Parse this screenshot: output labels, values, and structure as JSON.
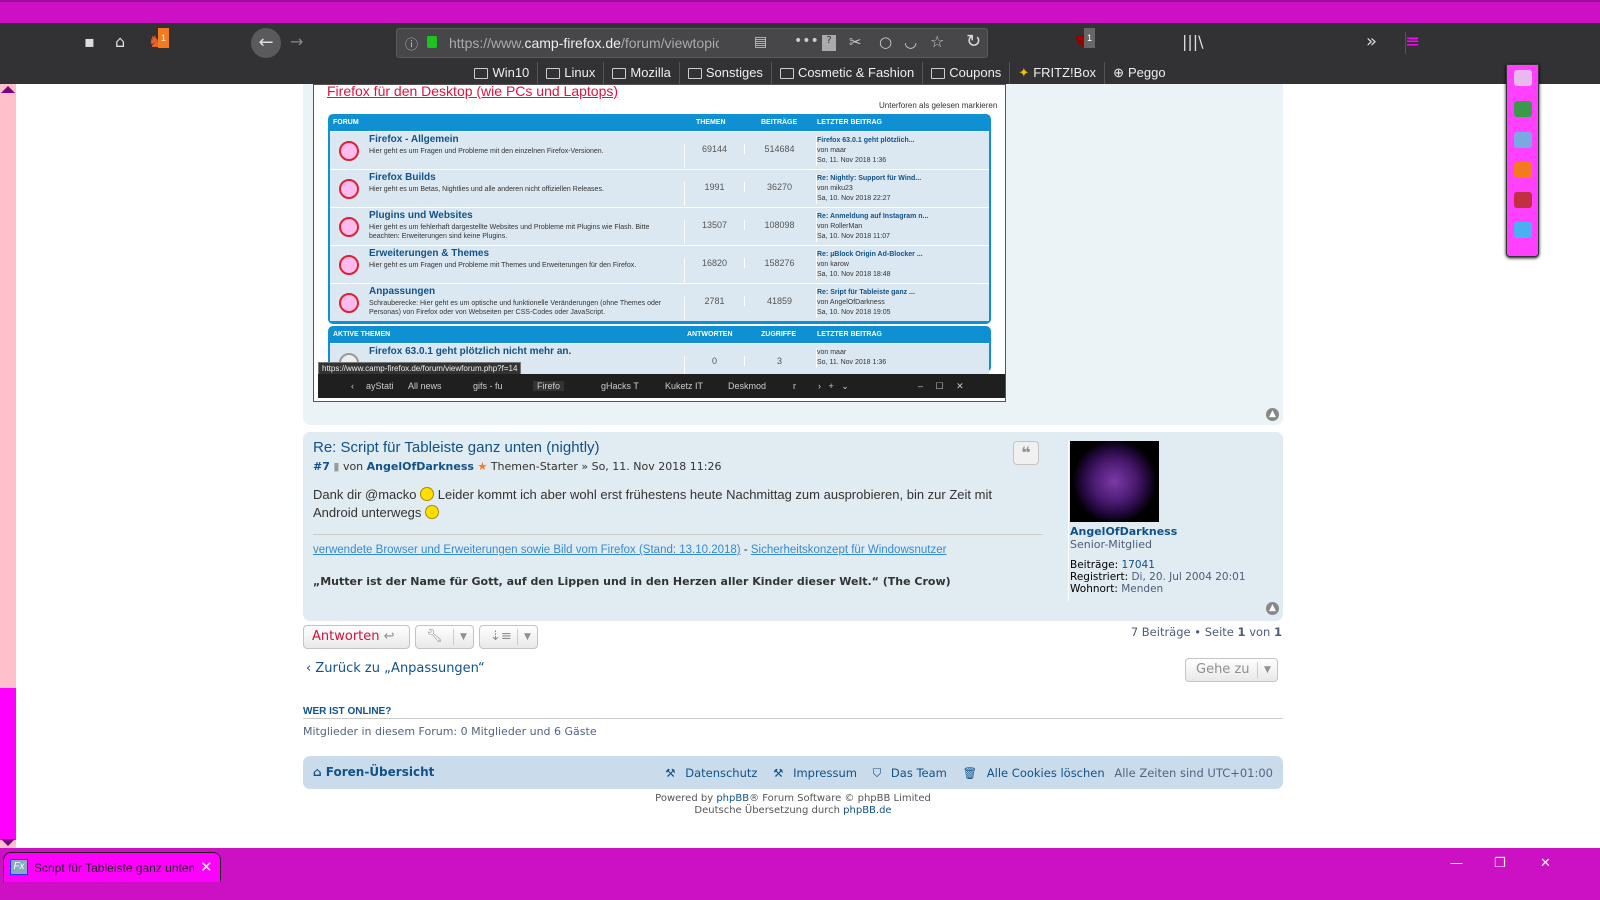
{
  "browser": {
    "url_prefix": "https://www.",
    "url_domain": "camp-firefox.de",
    "url_path": "/forum/viewtopic",
    "addon_badge": "1",
    "ublock_badge": "1",
    "bookmarks": [
      "Win10",
      "Linux",
      "Mozilla",
      "Sonstiges",
      "Cosmetic & Fashion",
      "Coupons",
      "FRITZ!Box",
      "Peggo"
    ],
    "tab_title": "Script für Tableiste ganz unten (nightly)",
    "tab_favicon": "Fx"
  },
  "embedded": {
    "title": "Firefox für den Desktop (wie PCs und Laptops)",
    "mark_read": "Unterforen als gelesen markieren",
    "headers": [
      "FORUM",
      "THEMEN",
      "BEITRÄGE",
      "LETZTER BEITRAG"
    ],
    "forums": [
      {
        "name": "Firefox - Allgemein",
        "desc": "Hier geht es um Fragen und Probleme mit den einzelnen Firefox-Versionen.",
        "topics": "69144",
        "posts": "514684",
        "last_title": "Firefox 63.0.1 geht plötzlich...",
        "last_by": "von maar",
        "last_date": "So, 11. Nov 2018 1:36"
      },
      {
        "name": "Firefox Builds",
        "desc": "Hier geht es um Betas, Nightlies und alle anderen nicht offiziellen Releases.",
        "topics": "1991",
        "posts": "36270",
        "last_title": "Re: Nightly: Support für Wind...",
        "last_by": "von miku23",
        "last_date": "Sa, 10. Nov 2018 22:27"
      },
      {
        "name": "Plugins und Websites",
        "desc": "Hier geht es um fehlerhaft dargestellte Websites und Probleme mit Plugins wie Flash. Bitte beachten: Erweiterungen sind keine Plugins.",
        "topics": "13507",
        "posts": "108098",
        "last_title": "Re: Anmeldung auf Instagram n...",
        "last_by": "von RollerMan",
        "last_date": "Sa, 10. Nov 2018 11:07"
      },
      {
        "name": "Erweiterungen & Themes",
        "desc": "Hier geht es um Fragen und Probleme mit Themes und Erweiterungen für den Firefox.",
        "topics": "16820",
        "posts": "158276",
        "last_title": "Re: µBlock Origin Ad-Blocker ...",
        "last_by": "von karow",
        "last_date": "Sa, 10. Nov 2018 18:48"
      },
      {
        "name": "Anpassungen",
        "desc": "Schrauberecke: Hier geht es um optische und funktionelle Veränderungen (ohne Themes oder Personas) von Firefox oder von Webseiten per CSS-Codes oder JavaScript.",
        "topics": "2781",
        "posts": "41859",
        "last_title": "Re: Sript für Tableiste ganz ...",
        "last_by": "von AngelOfDarkness",
        "last_date": "Sa, 10. Nov 2018 19:05"
      }
    ],
    "active_headers": [
      "AKTIVE THEMEN",
      "ANTWORTEN",
      "ZUGRIFFE",
      "LETZTER BEITRAG"
    ],
    "active": {
      "name": "Firefox 63.0.1 geht plötzlich nicht mehr an.",
      "replies": "0",
      "views": "3",
      "last_by": "von maar",
      "last_date": "So, 11. Nov 2018 1:36"
    },
    "status_url": "https://www.camp-firefox.de/forum/viewforum.php?f=14",
    "taskbar": [
      "ayStati",
      "All news",
      "gifs - fu",
      "Firefo",
      "gHacks T",
      "Kuketz IT",
      "Deskmod",
      "r"
    ]
  },
  "post": {
    "title": "Re: Script für Tableiste ganz unten (nightly)",
    "number": "#7",
    "by": "von",
    "author": "AngelOfDarkness",
    "starter": "Themen-Starter",
    "date": "» So, 11. Nov 2018 11:26",
    "body_1": "Dank dir @macko",
    "body_2": "Leider kommt ich aber wohl erst frühestens heute Nachmittag zum ausprobieren, bin zur Zeit mit Android unterwegs",
    "sig_link1": "verwendete Browser und Erweiterungen sowie Bild vom Firefox (Stand: 13.10.2018)",
    "sig_sep": " - ",
    "sig_link2": "Sicherheitskonzept für Windowsnutzer",
    "quote": "„Mutter ist der Name für Gott, auf den Lippen und in den Herzen aller Kinder dieser Welt.“ (The Crow)",
    "profile": {
      "name": "AngelOfDarkness",
      "rank": "Senior-Mitglied",
      "posts_label": "Beiträge:",
      "posts": "17041",
      "reg_label": "Registriert:",
      "reg": "Di, 20. Jul 2004 20:01",
      "loc_label": "Wohnort:",
      "loc": "Menden"
    }
  },
  "actions": {
    "reply": "Antworten",
    "pagination": "7 Beiträge • Seite",
    "page": "1",
    "of": "von",
    "total": "1",
    "back": "Zurück zu „Anpassungen“",
    "jump": "Gehe zu"
  },
  "online": {
    "heading": "WER IST ONLINE?",
    "text": "Mitglieder in diesem Forum: 0 Mitglieder und 6 Gäste"
  },
  "footer": {
    "home": "Foren-Übersicht",
    "privacy": "Datenschutz",
    "imprint": "Impressum",
    "team": "Das Team",
    "cookies": "Alle Cookies löschen",
    "tz": "Alle Zeiten sind UTC+01:00",
    "powered_1": "Powered by",
    "phpbb": "phpBB",
    "powered_2": "® Forum Software © phpBB Limited",
    "translation": "Deutsche Übersetzung durch",
    "translation_link": "phpBB.de"
  }
}
